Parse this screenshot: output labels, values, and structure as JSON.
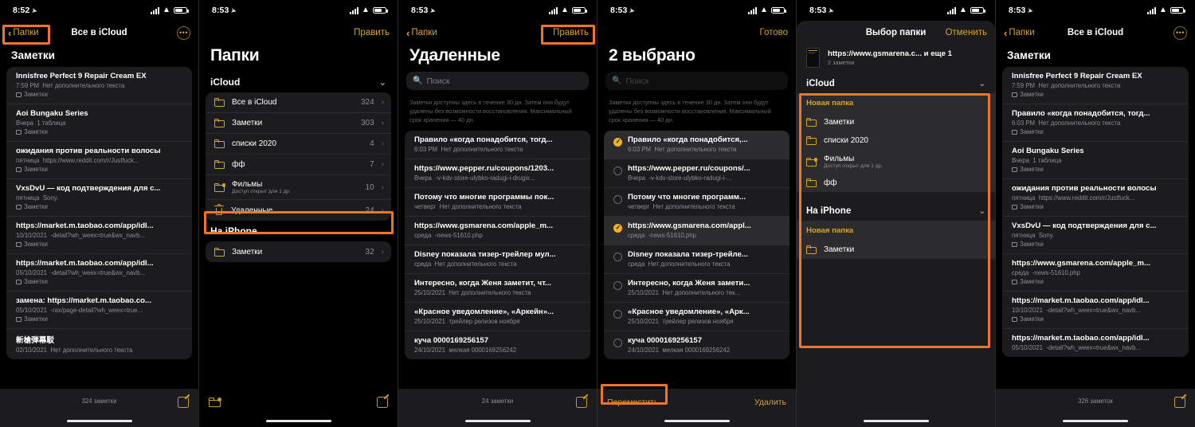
{
  "accent": "#d9a326",
  "highlight_color": "#f2732a",
  "status_bars": {
    "p1": "8:52",
    "p2": "8:53",
    "p3": "8:53",
    "p4": "8:53",
    "p5": "8:53",
    "p6": "8:53"
  },
  "panel1": {
    "nav": {
      "back": "Папки",
      "title": "Все в iCloud",
      "more_icon": "•••"
    },
    "section": "Заметки",
    "notes": [
      {
        "title": "Innisfree Perfect 9 Repair Cream EX",
        "meta": "7:59 PM",
        "preview": "Нет дополнительного текста",
        "folder": "Заметки"
      },
      {
        "title": "Aoi Bungaku Series",
        "meta": "Вчера",
        "preview": "1 таблица",
        "folder": "Заметки"
      },
      {
        "title": "ожидания против реальности волосы",
        "meta": "пятница",
        "preview": "https://www.reddit.com/r/Justfuck...",
        "folder": "Заметки"
      },
      {
        "title": "VxsDvU — код подтверждения для с...",
        "meta": "пятница",
        "preview": "Sony.",
        "folder": "Заметки"
      },
      {
        "title": "https://market.m.taobao.com/app/idl...",
        "meta": "10/10/2021",
        "preview": "-detail?wh_weex=true&wx_navb...",
        "folder": "Заметки"
      },
      {
        "title": "https://market.m.taobao.com/app/idl...",
        "meta": "05/10/2021",
        "preview": "-detail?wh_weex=true&wx_navb...",
        "folder": "Заметки"
      },
      {
        "title": "замена: https://market.m.taobao.co...",
        "meta": "05/10/2021",
        "preview": "-rax/page-detail?wh_weex=true...",
        "folder": "Заметки"
      },
      {
        "title": "新槍弾幕駁",
        "meta": "02/10/2021",
        "preview": "Нет дополнительного текста",
        "folder": ""
      }
    ],
    "bottom": {
      "count": "324 заметки",
      "compose_icon": "compose-icon"
    }
  },
  "panel2": {
    "nav": {
      "action": "Править"
    },
    "title": "Папки",
    "groups": [
      {
        "name": "iCloud",
        "rows": [
          {
            "name": "Все в iCloud",
            "sub": "",
            "count": "324",
            "icon": "folder-icon"
          },
          {
            "name": "Заметки",
            "sub": "",
            "count": "303",
            "icon": "folder-icon"
          },
          {
            "name": "списки 2020",
            "sub": "",
            "count": "4",
            "icon": "folder-icon"
          },
          {
            "name": "фф",
            "sub": "",
            "count": "7",
            "icon": "folder-icon"
          },
          {
            "name": "Фильмы",
            "sub": "Доступ открыт для 1 др.",
            "count": "10",
            "icon": "folder-shared-icon"
          },
          {
            "name": "Удаленные",
            "sub": "",
            "count": "24",
            "icon": "trash-icon"
          }
        ]
      },
      {
        "name": "На iPhone",
        "rows": [
          {
            "name": "Заметки",
            "sub": "",
            "count": "32",
            "icon": "folder-icon"
          }
        ]
      }
    ],
    "bottom": {
      "new_folder_icon": "new-folder-icon",
      "compose_icon": "compose-icon"
    }
  },
  "panel3": {
    "nav": {
      "back": "Папки",
      "action": "Править"
    },
    "title": "Удаленные",
    "search_placeholder": "Поиск",
    "notice": "Заметки доступны здесь в течение 30 дн. Затем они будут удалены без возможности восстановления. Максимальный срок хранения — 40 дн.",
    "notes": [
      {
        "title": "Правило «когда понадобится, тогд...",
        "meta": "6:03 PM",
        "preview": "Нет дополнительного текста"
      },
      {
        "title": "https://www.pepper.ru/coupons/1203...",
        "meta": "Вчера",
        "preview": "-v-kdv-store-ulybko-radugi-i-drugix..."
      },
      {
        "title": "Потому что многие программы пок...",
        "meta": "четверг",
        "preview": "Нет дополнительного текста"
      },
      {
        "title": "https://www.gsmarena.com/apple_m...",
        "meta": "среда",
        "preview": "-news-51610.php"
      },
      {
        "title": "Disney показала тизер-трейлер мул...",
        "meta": "среда",
        "preview": "Нет дополнительного текста"
      },
      {
        "title": "Интересно, когда Женя заметит, чт...",
        "meta": "25/10/2021",
        "preview": "Нет дополнительного текста"
      },
      {
        "title": "«Красное уведомление», «Аркейн»...",
        "meta": "25/10/2021",
        "preview": "трейлер релизов ноября"
      },
      {
        "title": "куча 0000169256157",
        "meta": "24/10/2021",
        "preview": "мелкая 0000169256242"
      }
    ],
    "bottom": {
      "count": "24 заметки",
      "compose_icon": "compose-icon"
    }
  },
  "panel4": {
    "nav": {
      "action": "Готово"
    },
    "title": "2 выбрано",
    "search_placeholder": "Поиск",
    "notice": "Заметки доступны здесь в течение 30 дн. Затем они будут удалены без возможности восстановления. Максимальный срок хранения — 40 дн.",
    "notes": [
      {
        "title": "Правило «когда понадобится,...",
        "meta": "6:03 PM",
        "preview": "Нет дополнительного текста",
        "selected": true
      },
      {
        "title": "https://www.pepper.ru/coupons/...",
        "meta": "Вчера",
        "preview": "-v-kdv-store-ulybko-radugi-i-...",
        "selected": false
      },
      {
        "title": "Потому что многие программ...",
        "meta": "четверг",
        "preview": "Нет дополнительного текста",
        "selected": false
      },
      {
        "title": "https://www.gsmarena.com/appl...",
        "meta": "среда",
        "preview": "-news-51610.php",
        "selected": true
      },
      {
        "title": "Disney показала тизер-трейле...",
        "meta": "среда",
        "preview": "Нет дополнительного текста",
        "selected": false
      },
      {
        "title": "Интересно, когда Женя замети...",
        "meta": "25/10/2021",
        "preview": "Нет дополнительного тек...",
        "selected": false
      },
      {
        "title": "«Красное уведомление», «Арк...",
        "meta": "25/10/2021",
        "preview": "трейлер релизов ноября",
        "selected": false
      },
      {
        "title": "куча 0000169256157",
        "meta": "24/10/2021",
        "preview": "мелкая 0000169256242",
        "selected": false
      }
    ],
    "bottom": {
      "move": "Переместить",
      "delete": "Удалить"
    }
  },
  "panel5": {
    "sheet_nav": {
      "title": "Выбор папки",
      "cancel": "Отменить"
    },
    "item": {
      "title": "https://www.gsmarena.c... и еще 1",
      "sub": "2 заметки"
    },
    "groups": [
      {
        "name": "iCloud",
        "new_folder": "Новая папка",
        "rows": [
          {
            "name": "Заметки",
            "sub": ""
          },
          {
            "name": "списки 2020",
            "sub": ""
          },
          {
            "name": "Фильмы",
            "sub": "Доступ открыт для 1 др."
          },
          {
            "name": "фф",
            "sub": ""
          }
        ]
      },
      {
        "name": "На iPhone",
        "new_folder": "Новая папка",
        "rows": [
          {
            "name": "Заметки",
            "sub": ""
          }
        ]
      }
    ]
  },
  "panel6": {
    "nav": {
      "back": "Папки",
      "title": "Все в iCloud",
      "more_icon": "•••"
    },
    "section": "Заметки",
    "notes": [
      {
        "title": "Innisfree Perfect 9 Repair Cream EX",
        "meta": "7:59 PM",
        "preview": "Нет дополнительного текста",
        "folder": "Заметки"
      },
      {
        "title": "Правило «когда понадобится, тогд...",
        "meta": "6:03 PM",
        "preview": "Нет дополнительного текста",
        "folder": "Заметки"
      },
      {
        "title": "Aoi Bungaku Series",
        "meta": "Вчера",
        "preview": "1 таблица",
        "folder": "Заметки"
      },
      {
        "title": "ожидания против реальности волосы",
        "meta": "пятница",
        "preview": "https://www.reddit.com/r/Justfuck...",
        "folder": "Заметки"
      },
      {
        "title": "VxsDvU — код подтверждения для с...",
        "meta": "пятница",
        "preview": "Sony.",
        "folder": "Заметки"
      },
      {
        "title": "https://www.gsmarena.com/apple_m...",
        "meta": "среда",
        "preview": "-news-51610.php",
        "folder": "Заметки"
      },
      {
        "title": "https://market.m.taobao.com/app/idl...",
        "meta": "10/10/2021",
        "preview": "-detail?wh_weex=true&wx_navb...",
        "folder": "Заметки"
      },
      {
        "title": "https://market.m.taobao.com/app/idl...",
        "meta": "05/10/2021",
        "preview": "-detail?wh_weex=true&wx_navb...",
        "folder": ""
      }
    ],
    "bottom": {
      "count": "326 заметок",
      "compose_icon": "compose-icon"
    }
  }
}
